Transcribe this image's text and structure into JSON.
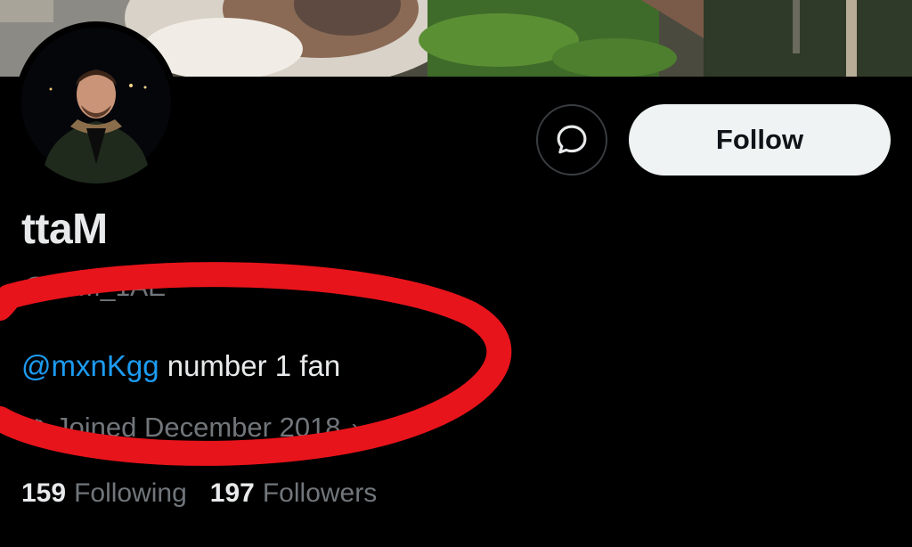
{
  "profile": {
    "display_name": "ttaM",
    "handle": "@ttaM_1AE",
    "bio_mention": "@mxnKgg",
    "bio_text": " number 1 fan",
    "joined": "Joined December 2018",
    "following_count": "159",
    "following_label": "Following",
    "followers_count": "197",
    "followers_label": "Followers"
  },
  "actions": {
    "follow_label": "Follow",
    "message_icon": "message-bubble-icon"
  },
  "colors": {
    "background": "#000000",
    "mention": "#1d9bf0",
    "secondary_text": "#71767b",
    "follow_button": "#eff3f4",
    "annotation_circle": "#e8141b"
  }
}
